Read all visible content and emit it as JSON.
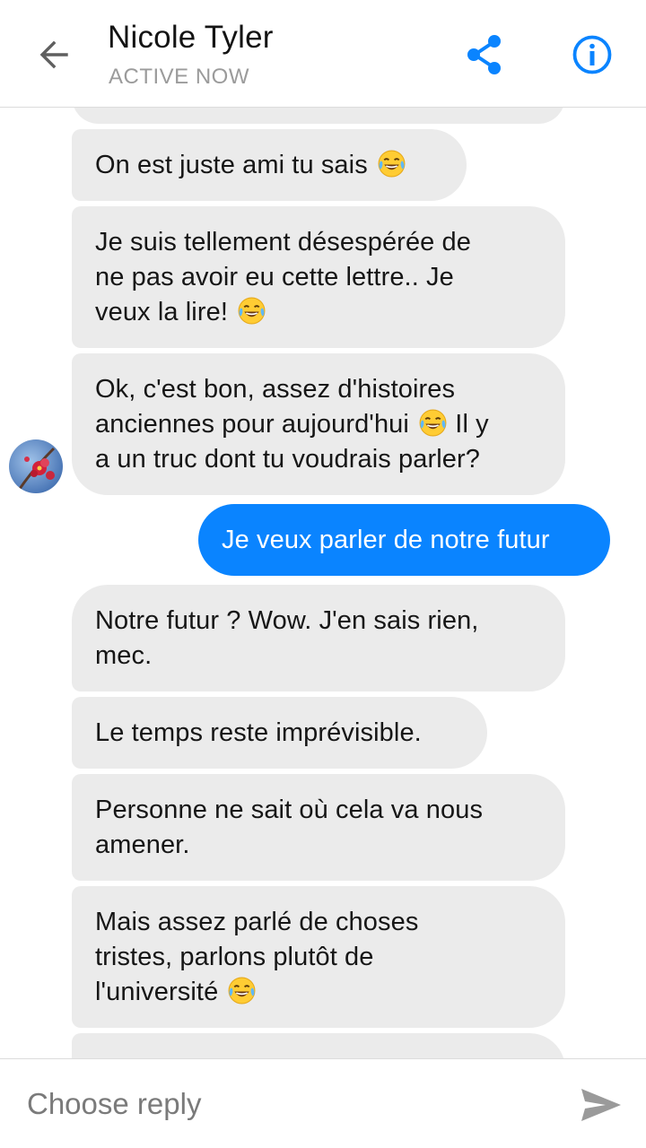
{
  "header": {
    "contact_name": "Nicole Tyler",
    "status": "ACTIVE NOW",
    "back_icon": "arrow-left-icon",
    "share_icon": "share-icon",
    "info_icon": "info-icon"
  },
  "colors": {
    "accent": "#0a84ff",
    "incoming_bubble": "#ebebeb",
    "status_text": "#9b9b9b"
  },
  "messages": [
    {
      "from": "contact",
      "lines": [
        "On est juste ami tu sais"
      ],
      "emoji": "tears-of-joy-emoji"
    },
    {
      "from": "contact",
      "lines": [
        "Je suis tellement désespérée de",
        "ne pas avoir eu cette lettre.. Je",
        "veux la lire!"
      ],
      "emoji": "tears-of-joy-emoji"
    },
    {
      "from": "contact",
      "lines": [
        "Ok, c'est bon, assez d'histoires",
        "anciennes pour aujourd'hui",
        "Il y",
        "a un truc dont tu voudrais parler?"
      ],
      "emoji": "tears-of-joy-emoji"
    },
    {
      "from": "me",
      "lines": [
        "Je veux parler de notre futur"
      ]
    },
    {
      "from": "contact",
      "lines": [
        "Notre futur ? Wow. J'en sais rien,",
        "mec."
      ]
    },
    {
      "from": "contact",
      "lines": [
        "Le temps reste imprévisible."
      ]
    },
    {
      "from": "contact",
      "lines": [
        "Personne ne sait où cela va nous",
        "amener."
      ]
    },
    {
      "from": "contact",
      "lines": [
        "Mais assez parlé de choses",
        "tristes, parlons plutôt de",
        "l'université"
      ],
      "emoji": "tears-of-joy-emoji"
    }
  ],
  "composer": {
    "placeholder": "Choose reply",
    "send_icon": "send-icon"
  }
}
